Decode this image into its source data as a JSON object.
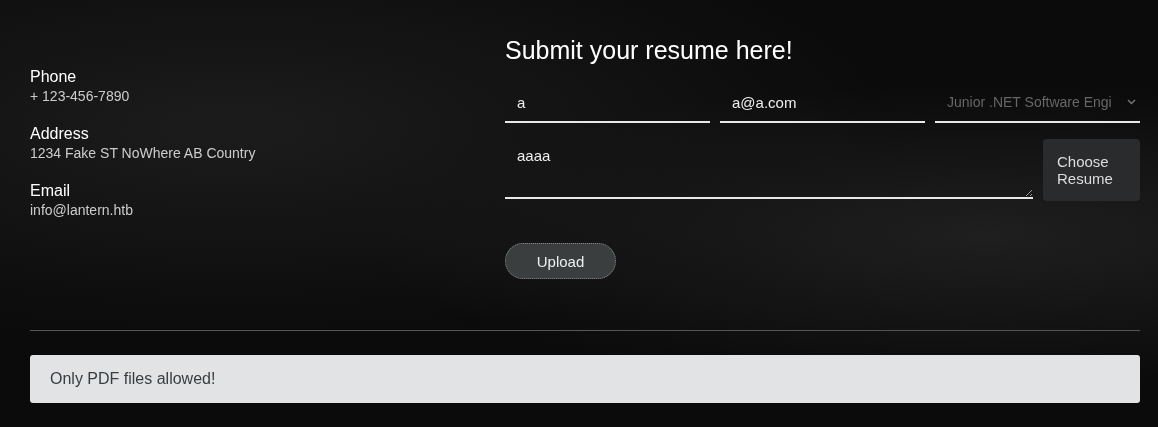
{
  "contact": [
    {
      "label": "Phone",
      "value": "+ 123-456-7890"
    },
    {
      "label": "Address",
      "value": "1234 Fake ST NoWhere AB Country"
    },
    {
      "label": "Email",
      "value": "info@lantern.htb"
    }
  ],
  "form": {
    "title": "Submit your resume here!",
    "name": "a",
    "email": "a@a.com",
    "position": "Junior .NET Software Engi",
    "message": "aaaa",
    "choose_button": "Choose Resume",
    "upload_button": "Upload"
  },
  "alert": "Only PDF files allowed!"
}
